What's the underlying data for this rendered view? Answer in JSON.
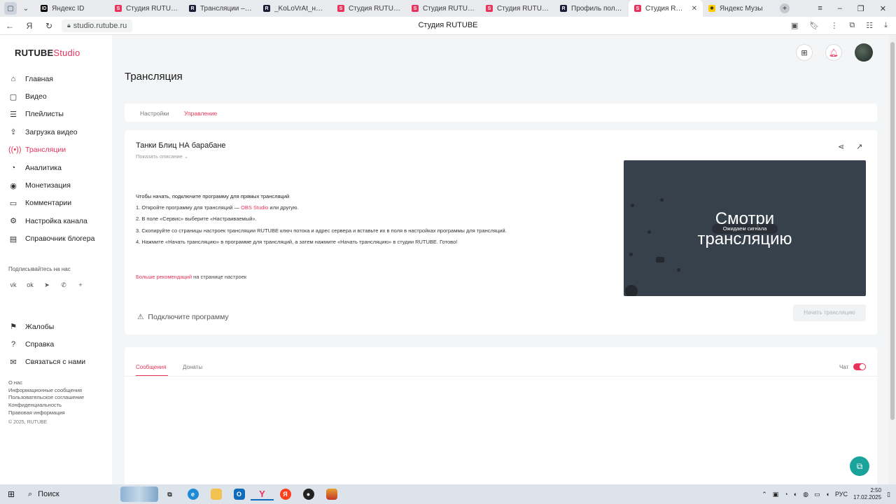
{
  "browser": {
    "tabs": [
      {
        "label": "Яндекс ID",
        "fav": "yid",
        "glyph": "ID"
      },
      {
        "label": "Студия RUTUBE",
        "fav": "studio",
        "glyph": "S"
      },
      {
        "label": "Трансляции – смо",
        "fav": "r",
        "glyph": "R"
      },
      {
        "label": "_KoLoVrAt_на RUT",
        "fav": "r",
        "glyph": "R"
      },
      {
        "label": "Студия RUTUBE",
        "fav": "studio",
        "glyph": "S"
      },
      {
        "label": "Студия RUTUBE",
        "fav": "studio",
        "glyph": "S"
      },
      {
        "label": "Студия RUTUBE",
        "fav": "studio",
        "glyph": "S"
      },
      {
        "label": "Профиль пользова",
        "fav": "r",
        "glyph": "R"
      },
      {
        "label": "Студия RUTUBE",
        "fav": "studio",
        "glyph": "S",
        "active": true
      },
      {
        "label": "Яндекс Музы",
        "fav": "ym",
        "glyph": "✱"
      }
    ],
    "url": "studio.rutube.ru",
    "page_title": "Студия RUTUBE"
  },
  "sidebar": {
    "logo_main": "RUTUBE",
    "logo_accent": "Studio",
    "items": [
      {
        "label": "Главная",
        "icon": "home-icon",
        "glyph": "⌂"
      },
      {
        "label": "Видео",
        "icon": "video-icon",
        "glyph": "▢"
      },
      {
        "label": "Плейлисты",
        "icon": "playlist-icon",
        "glyph": "☰"
      },
      {
        "label": "Загрузка видео",
        "icon": "upload-icon",
        "glyph": "⇪"
      },
      {
        "label": "Трансляции",
        "icon": "broadcast-icon",
        "glyph": "((•))",
        "active": true
      },
      {
        "label": "Аналитика",
        "icon": "analytics-icon",
        "glyph": "◔"
      },
      {
        "label": "Монетизация",
        "icon": "monetization-icon",
        "glyph": "◉"
      },
      {
        "label": "Комментарии",
        "icon": "comments-icon",
        "glyph": "▭"
      },
      {
        "label": "Настройка канала",
        "icon": "settings-icon",
        "glyph": "⚙"
      },
      {
        "label": "Справочник блогера",
        "icon": "guide-icon",
        "glyph": "▤"
      }
    ],
    "follow_label": "Подписывайтесь на нас",
    "socials": [
      {
        "name": "vk-icon",
        "glyph": "vk"
      },
      {
        "name": "ok-icon",
        "glyph": "ok"
      },
      {
        "name": "telegram-icon",
        "glyph": "➤"
      },
      {
        "name": "viber-icon",
        "glyph": "✆"
      },
      {
        "name": "more-icon",
        "glyph": "+"
      }
    ],
    "items2": [
      {
        "label": "Жалобы",
        "icon": "flag-icon",
        "glyph": "⚑"
      },
      {
        "label": "Справка",
        "icon": "help-icon",
        "glyph": "?"
      },
      {
        "label": "Связаться с нами",
        "icon": "mail-icon",
        "glyph": "✉"
      }
    ],
    "links": [
      "О нас",
      "Информационные сообщения",
      "Пользовательское соглашение",
      "Конфиденциальность",
      "Правовая информация"
    ],
    "copyright": "© 2025, RUTUBE"
  },
  "page": {
    "heading": "Трансляция",
    "tabs": [
      "Настройки",
      "Управление"
    ],
    "stream_title": "Танки Блиц НА барабане",
    "show_description": "Показать описание ⌄",
    "instructions_head": "Чтобы начать, подключите программу для прямых трансляций",
    "step1_pre": "1. Откройте программу для трансляций — ",
    "step1_link": "OBS Studio",
    "step1_post": " или другую.",
    "step2": "2. В поле «Сервис» выберите «Настраиваемый».",
    "step3": "3. Скопируйте со страницы настроек трансляции RUTUBE ключ потока и адрес сервера и вставьте их в поля в настройках программы для трансляций.",
    "step4": "4. Нажмите «Начать трансляцию» в программе для трансляций, а затем нажмите «Начать трансляцию» в студии RUTUBE. Готово!",
    "more_link": "Больше рекомендаций",
    "more_post": " на странице настроек",
    "connect_label": "Подключите программу",
    "player_line1": "Смотри",
    "player_line2": "трансляцию",
    "waiting": "Ожидаем сигнала",
    "start_button": "Начать трансляцию"
  },
  "chat": {
    "tabs": [
      "Сообщения",
      "Донаты"
    ],
    "toggle_label": "Чат",
    "toggle_on": true
  },
  "taskbar": {
    "search": "Поиск",
    "lang": "РУС",
    "time": "2:50",
    "date": "17.02.2025"
  },
  "colors": {
    "accent": "#e8335a",
    "player_bg": "#37414b",
    "help_fab": "#1aa39a"
  }
}
